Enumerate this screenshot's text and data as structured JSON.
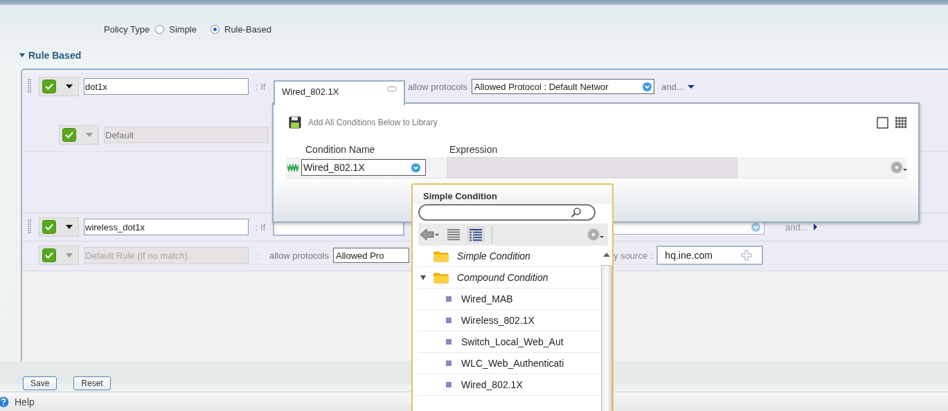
{
  "policy_type": {
    "label": "Policy Type",
    "options": [
      {
        "label": "Simple",
        "selected": false
      },
      {
        "label": "Rule-Based",
        "selected": true
      }
    ]
  },
  "section": {
    "title": "Rule Based",
    "expanded": true
  },
  "rules": [
    {
      "kind": "rule",
      "enabled": true,
      "name": "dot1x",
      "if_label": ": If",
      "protocols_label": "allow protocols",
      "protocols": "Allowed Protocol : Default Networ",
      "more": {
        "label": "and...",
        "expanded": true
      },
      "children": [
        {
          "disabled": true,
          "enabled": true,
          "name": "Default"
        }
      ]
    },
    {
      "kind": "rule",
      "enabled": true,
      "name": "wireless_dot1x",
      "if_label": ": If",
      "more": {
        "label": "and...",
        "expanded": false
      }
    },
    {
      "kind": "default",
      "enabled": true,
      "placeholder": "Default Rule (If no match)",
      "separator": ":",
      "protocols_label": "allow protocols",
      "protocols": "Allowed Pro",
      "source_label": "y source :",
      "source": "hq.ine.com"
    }
  ],
  "condition_panel": {
    "tab": "Wired_802.1X",
    "save_label": "Add All Conditions Below to Library",
    "columns": [
      "Condition Name",
      "Expression"
    ],
    "conditions": [
      {
        "name": "Wired_802.1X"
      }
    ]
  },
  "picker": {
    "title": "Simple Condition",
    "views": [
      {
        "kind": "list",
        "selected": false
      },
      {
        "kind": "tree",
        "selected": true
      }
    ],
    "tree": [
      {
        "label": "Simple Condition"
      },
      {
        "label": "Compound Condition",
        "expanded": true,
        "children": [
          {
            "label": "Wired_MAB"
          },
          {
            "label": "Wireless_802.1X"
          },
          {
            "label": "Switch_Local_Web_Aut"
          },
          {
            "label": "WLC_Web_Authenticati"
          },
          {
            "label": "Wired_802.1X"
          }
        ]
      }
    ]
  },
  "footer": {
    "buttons": [
      "Save",
      "Reset"
    ],
    "help": "Help"
  }
}
